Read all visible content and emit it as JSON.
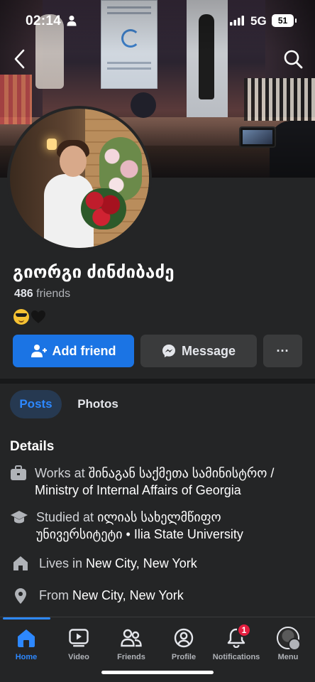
{
  "status_bar": {
    "time": "02:14",
    "network": "5G",
    "battery": "51"
  },
  "profile": {
    "name": "გიორგი ძინძიბაძე",
    "friends_count": "486",
    "friends_label": "friends",
    "emoji_status": [
      "sunglasses-emoji",
      "black-heart-emoji"
    ]
  },
  "actions": {
    "add_friend": "Add friend",
    "message": "Message",
    "more": "···"
  },
  "tabs": [
    {
      "label": "Posts",
      "active": true
    },
    {
      "label": "Photos",
      "active": false
    }
  ],
  "details": {
    "title": "Details",
    "work_prefix": "Works at ",
    "work_value": "შინაგან საქმეთა სამინისტრო / Ministry of Internal Affairs of Georgia",
    "study_prefix": "Studied at ",
    "study_value": "ილიას სახელმწიფო უნივერსიტეტი • Ilia State University",
    "lives_prefix": "Lives in ",
    "lives_value": "New City, New York",
    "from_prefix": "From ",
    "from_value": "New City, New York"
  },
  "bottom_nav": {
    "items": [
      {
        "label": "Home",
        "icon": "home-icon",
        "active": true
      },
      {
        "label": "Video",
        "icon": "video-icon",
        "active": false
      },
      {
        "label": "Friends",
        "icon": "friends-icon",
        "active": false
      },
      {
        "label": "Profile",
        "icon": "profile-icon",
        "active": false
      },
      {
        "label": "Notifications",
        "icon": "bell-icon",
        "active": false,
        "badge": "1"
      },
      {
        "label": "Menu",
        "icon": "menu-avatar",
        "active": false
      }
    ]
  },
  "colors": {
    "background": "#242526",
    "accent": "#1b74e4",
    "active_tab": "#2d88ff",
    "badge": "#e41e3f"
  }
}
